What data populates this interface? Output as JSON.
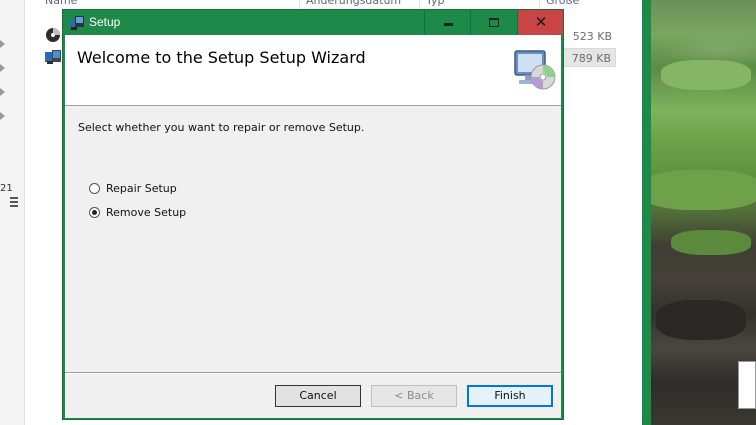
{
  "explorer": {
    "columns": [
      "Name",
      "Änderungsdatum",
      "Typ",
      "Größe"
    ],
    "rows": [
      {
        "icon": "cd-disc-icon",
        "size": "523 KB",
        "selected": false
      },
      {
        "icon": "installer-icon",
        "size": "789 KB",
        "selected": true
      }
    ],
    "side_number": "21"
  },
  "dialog": {
    "title": "Setup",
    "controls": {
      "minimize": "minimize-icon",
      "maximize": "maximize-icon",
      "close": "close-icon"
    },
    "heading": "Welcome to the Setup Setup Wizard",
    "banner_icon": "computer-cd-icon",
    "prompt": "Select whether you want to repair or remove Setup.",
    "options": [
      {
        "label": "Repair Setup",
        "checked": false
      },
      {
        "label": "Remove Setup",
        "checked": true
      }
    ],
    "buttons": {
      "cancel": "Cancel",
      "back": "< Back",
      "finish": "Finish"
    }
  },
  "colors": {
    "titlebar": "#1e8a4a",
    "close_button": "#c94545",
    "default_button_border": "#0078d7"
  }
}
